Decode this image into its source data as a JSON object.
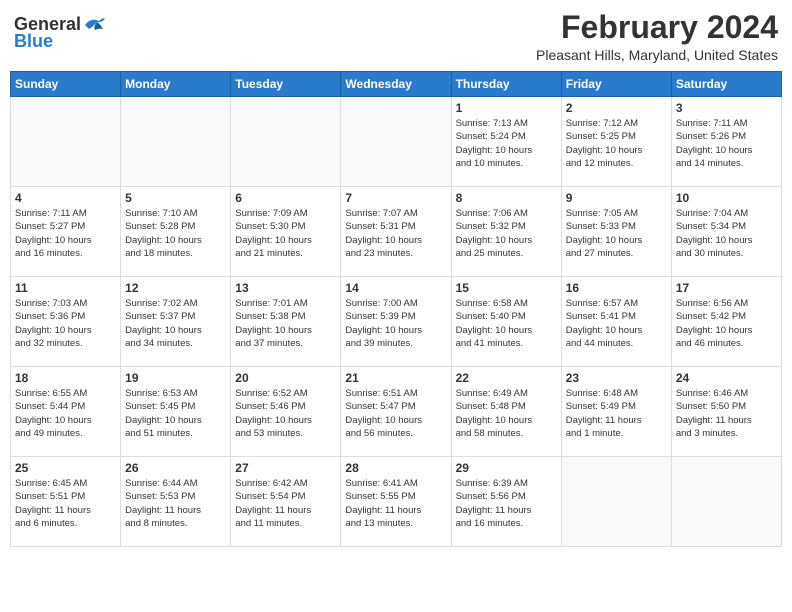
{
  "header": {
    "logo_general": "General",
    "logo_blue": "Blue",
    "month_year": "February 2024",
    "location": "Pleasant Hills, Maryland, United States"
  },
  "weekdays": [
    "Sunday",
    "Monday",
    "Tuesday",
    "Wednesday",
    "Thursday",
    "Friday",
    "Saturday"
  ],
  "weeks": [
    [
      {
        "day": "",
        "info": ""
      },
      {
        "day": "",
        "info": ""
      },
      {
        "day": "",
        "info": ""
      },
      {
        "day": "",
        "info": ""
      },
      {
        "day": "1",
        "info": "Sunrise: 7:13 AM\nSunset: 5:24 PM\nDaylight: 10 hours\nand 10 minutes."
      },
      {
        "day": "2",
        "info": "Sunrise: 7:12 AM\nSunset: 5:25 PM\nDaylight: 10 hours\nand 12 minutes."
      },
      {
        "day": "3",
        "info": "Sunrise: 7:11 AM\nSunset: 5:26 PM\nDaylight: 10 hours\nand 14 minutes."
      }
    ],
    [
      {
        "day": "4",
        "info": "Sunrise: 7:11 AM\nSunset: 5:27 PM\nDaylight: 10 hours\nand 16 minutes."
      },
      {
        "day": "5",
        "info": "Sunrise: 7:10 AM\nSunset: 5:28 PM\nDaylight: 10 hours\nand 18 minutes."
      },
      {
        "day": "6",
        "info": "Sunrise: 7:09 AM\nSunset: 5:30 PM\nDaylight: 10 hours\nand 21 minutes."
      },
      {
        "day": "7",
        "info": "Sunrise: 7:07 AM\nSunset: 5:31 PM\nDaylight: 10 hours\nand 23 minutes."
      },
      {
        "day": "8",
        "info": "Sunrise: 7:06 AM\nSunset: 5:32 PM\nDaylight: 10 hours\nand 25 minutes."
      },
      {
        "day": "9",
        "info": "Sunrise: 7:05 AM\nSunset: 5:33 PM\nDaylight: 10 hours\nand 27 minutes."
      },
      {
        "day": "10",
        "info": "Sunrise: 7:04 AM\nSunset: 5:34 PM\nDaylight: 10 hours\nand 30 minutes."
      }
    ],
    [
      {
        "day": "11",
        "info": "Sunrise: 7:03 AM\nSunset: 5:36 PM\nDaylight: 10 hours\nand 32 minutes."
      },
      {
        "day": "12",
        "info": "Sunrise: 7:02 AM\nSunset: 5:37 PM\nDaylight: 10 hours\nand 34 minutes."
      },
      {
        "day": "13",
        "info": "Sunrise: 7:01 AM\nSunset: 5:38 PM\nDaylight: 10 hours\nand 37 minutes."
      },
      {
        "day": "14",
        "info": "Sunrise: 7:00 AM\nSunset: 5:39 PM\nDaylight: 10 hours\nand 39 minutes."
      },
      {
        "day": "15",
        "info": "Sunrise: 6:58 AM\nSunset: 5:40 PM\nDaylight: 10 hours\nand 41 minutes."
      },
      {
        "day": "16",
        "info": "Sunrise: 6:57 AM\nSunset: 5:41 PM\nDaylight: 10 hours\nand 44 minutes."
      },
      {
        "day": "17",
        "info": "Sunrise: 6:56 AM\nSunset: 5:42 PM\nDaylight: 10 hours\nand 46 minutes."
      }
    ],
    [
      {
        "day": "18",
        "info": "Sunrise: 6:55 AM\nSunset: 5:44 PM\nDaylight: 10 hours\nand 49 minutes."
      },
      {
        "day": "19",
        "info": "Sunrise: 6:53 AM\nSunset: 5:45 PM\nDaylight: 10 hours\nand 51 minutes."
      },
      {
        "day": "20",
        "info": "Sunrise: 6:52 AM\nSunset: 5:46 PM\nDaylight: 10 hours\nand 53 minutes."
      },
      {
        "day": "21",
        "info": "Sunrise: 6:51 AM\nSunset: 5:47 PM\nDaylight: 10 hours\nand 56 minutes."
      },
      {
        "day": "22",
        "info": "Sunrise: 6:49 AM\nSunset: 5:48 PM\nDaylight: 10 hours\nand 58 minutes."
      },
      {
        "day": "23",
        "info": "Sunrise: 6:48 AM\nSunset: 5:49 PM\nDaylight: 11 hours\nand 1 minute."
      },
      {
        "day": "24",
        "info": "Sunrise: 6:46 AM\nSunset: 5:50 PM\nDaylight: 11 hours\nand 3 minutes."
      }
    ],
    [
      {
        "day": "25",
        "info": "Sunrise: 6:45 AM\nSunset: 5:51 PM\nDaylight: 11 hours\nand 6 minutes."
      },
      {
        "day": "26",
        "info": "Sunrise: 6:44 AM\nSunset: 5:53 PM\nDaylight: 11 hours\nand 8 minutes."
      },
      {
        "day": "27",
        "info": "Sunrise: 6:42 AM\nSunset: 5:54 PM\nDaylight: 11 hours\nand 11 minutes."
      },
      {
        "day": "28",
        "info": "Sunrise: 6:41 AM\nSunset: 5:55 PM\nDaylight: 11 hours\nand 13 minutes."
      },
      {
        "day": "29",
        "info": "Sunrise: 6:39 AM\nSunset: 5:56 PM\nDaylight: 11 hours\nand 16 minutes."
      },
      {
        "day": "",
        "info": ""
      },
      {
        "day": "",
        "info": ""
      }
    ]
  ]
}
